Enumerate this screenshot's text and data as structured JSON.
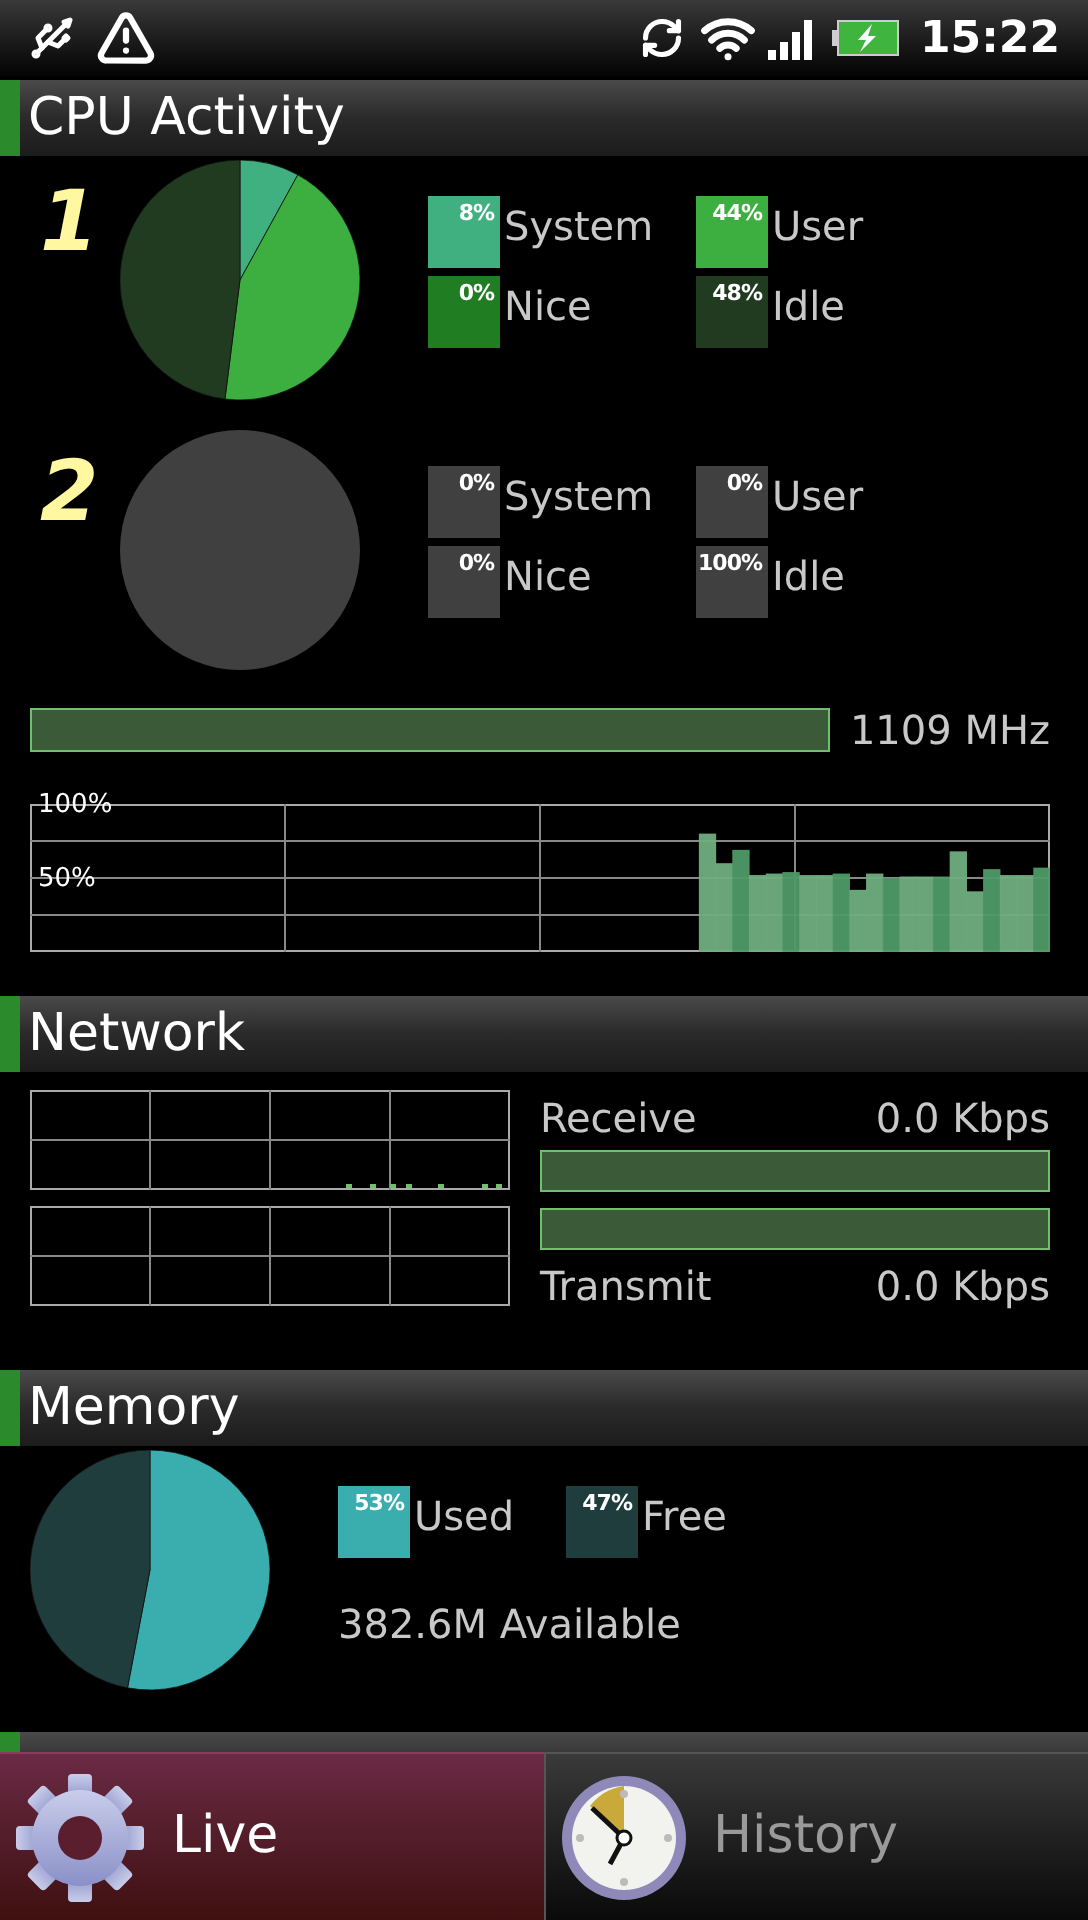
{
  "status_bar": {
    "time": "15:22"
  },
  "sections": [
    {
      "kind": "cpu",
      "title": "CPU Activity",
      "cores": [
        {
          "number": "1",
          "chart_data": {
            "type": "pie",
            "categories": [
              "System",
              "User",
              "Nice",
              "Idle"
            ],
            "values": [
              8,
              44,
              0,
              48
            ]
          },
          "legend": [
            {
              "percent": "8%",
              "color": "#40b080"
            },
            {
              "percent": "44%",
              "color": "#3daf40"
            },
            {
              "percent": "0%",
              "color": "#217d21"
            },
            {
              "percent": "48%",
              "color": "#203b20"
            }
          ]
        },
        {
          "number": "2",
          "chart_data": {
            "type": "pie",
            "categories": [
              "System",
              "User",
              "Nice",
              "Idle"
            ],
            "values": [
              0,
              0,
              0,
              100
            ]
          },
          "legend": [
            {
              "percent": "0%",
              "color": "#404040"
            },
            {
              "percent": "0%",
              "color": "#404040"
            },
            {
              "percent": "0%",
              "color": "#404040"
            },
            {
              "percent": "100%",
              "color": "#404040"
            }
          ]
        }
      ],
      "frequency": {
        "level": 1,
        "reading": "1109 MHz"
      },
      "history": {
        "chart_data": {
          "type": "bar",
          "ylim": [
            0,
            100
          ],
          "yticks": [
            {
              "value": 100,
              "label": "100%"
            },
            {
              "value": 50,
              "label": "50%"
            }
          ],
          "values": [
            null,
            null,
            null,
            null,
            null,
            null,
            null,
            null,
            null,
            null,
            null,
            null,
            null,
            null,
            null,
            null,
            null,
            null,
            null,
            null,
            null,
            null,
            null,
            null,
            null,
            null,
            null,
            null,
            null,
            null,
            null,
            null,
            null,
            null,
            null,
            null,
            null,
            null,
            null,
            null,
            80,
            60,
            69,
            52,
            53,
            54,
            52,
            52,
            53,
            42,
            53,
            50,
            51,
            51,
            51,
            68,
            41,
            56,
            52,
            52,
            57
          ]
        }
      }
    },
    {
      "kind": "network",
      "title": "Network",
      "meters": [
        {
          "label": "Receive",
          "reading": "0.0 Kbps",
          "level": 1
        },
        {
          "label": "Transmit",
          "reading": "0.0 Kbps",
          "level": 1
        }
      ]
    },
    {
      "kind": "memory",
      "title": "Memory",
      "chart_data": {
        "type": "pie",
        "categories": [
          "Used",
          "Free"
        ],
        "values": [
          53,
          47
        ]
      },
      "legend": [
        {
          "percent": "53%",
          "color": "#3aaeae"
        },
        {
          "percent": "47%",
          "color": "#1f3d3d"
        }
      ],
      "available": "382.6M Available"
    },
    {
      "kind": "storage"
    }
  ],
  "tabs": [
    {
      "label": "Live",
      "selected": true
    },
    {
      "label": "History",
      "selected": false
    }
  ]
}
